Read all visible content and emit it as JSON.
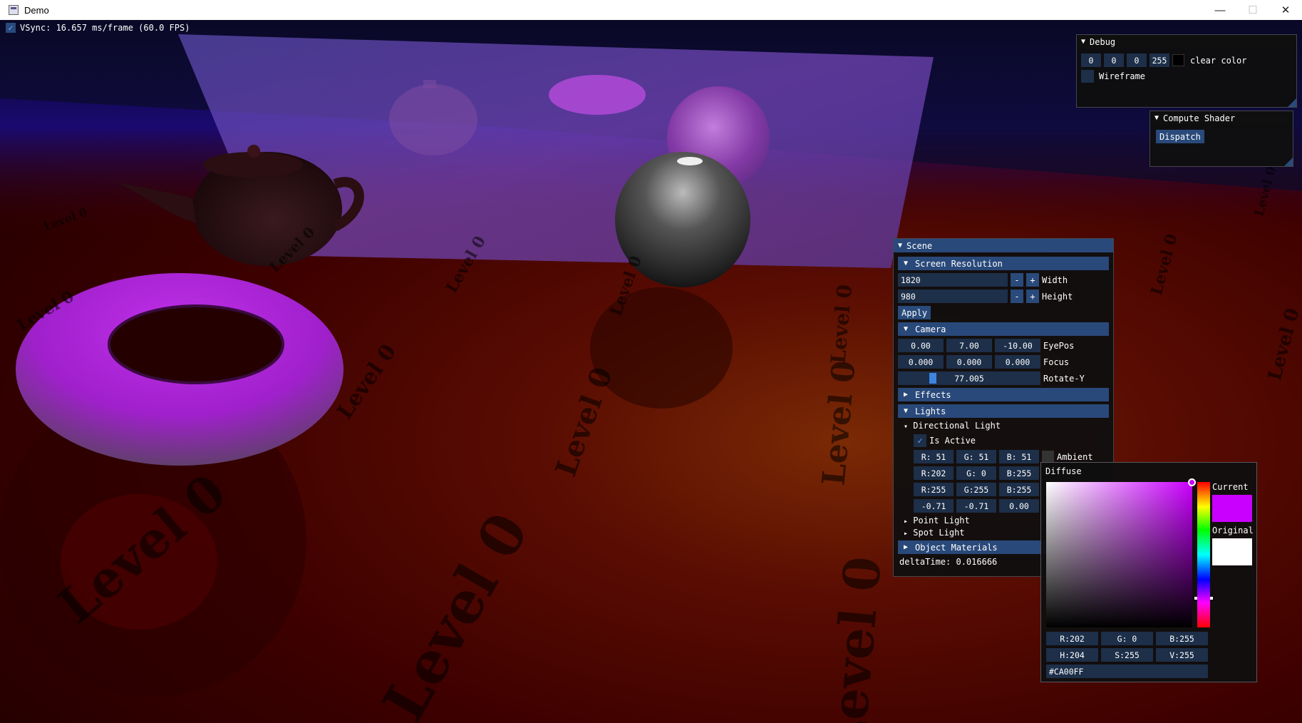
{
  "window": {
    "title": "Demo",
    "minimize_icon": "minimize-icon",
    "maximize_icon": "maximize-icon",
    "close_icon": "close-icon"
  },
  "overlay": {
    "vsync_label": "VSync: 16.657 ms/frame (60.0 FPS)",
    "vsync_checked": true
  },
  "scene_text": {
    "level_label": "Level 0"
  },
  "debug": {
    "title": "Debug",
    "clear_color": {
      "r": "0",
      "g": "0",
      "b": "0",
      "a": "255",
      "label": "clear color",
      "swatch": "#000000"
    },
    "wireframe_label": "Wireframe",
    "wireframe_checked": false
  },
  "compute": {
    "title": "Compute Shader",
    "dispatch_label": "Dispatch"
  },
  "scene": {
    "title": "Scene",
    "screen_resolution": {
      "header": "Screen Resolution",
      "width_value": "1820",
      "width_label": "Width",
      "height_value": "980",
      "height_label": "Height",
      "minus": "-",
      "plus": "+",
      "apply_label": "Apply"
    },
    "camera": {
      "header": "Camera",
      "eyepos": [
        "0.00",
        "7.00",
        "-10.00"
      ],
      "eyepos_label": "EyePos",
      "focus": [
        "0.000",
        "0.000",
        "0.000"
      ],
      "focus_label": "Focus",
      "rotate_value": "77.005",
      "rotate_label": "Rotate-Y"
    },
    "effects_header": "Effects",
    "lights": {
      "header": "Lights",
      "directional": "Directional Light",
      "is_active_label": "Is Active",
      "is_active_checked": true,
      "ambient": [
        "R: 51",
        "G: 51",
        "B: 51"
      ],
      "ambient_label": "Ambient",
      "ambient_swatch": "#333333",
      "diffuse": [
        "R:202",
        "G:  0",
        "B:255"
      ],
      "specular": [
        "R:255",
        "G:255",
        "B:255"
      ],
      "direction": [
        "-0.71",
        "-0.71",
        "0.00"
      ],
      "point_light": "Point Light",
      "spot_light": "Spot Light"
    },
    "object_materials": "Object Materials",
    "delta_time": "deltaTime: 0.016666"
  },
  "picker": {
    "title": "Diffuse",
    "current_label": "Current",
    "original_label": "Original",
    "current_color": "#CA00FF",
    "original_color": "#FFFFFF",
    "rgb": [
      "R:202",
      "G:  0",
      "B:255"
    ],
    "hsv": [
      "H:204",
      "S:255",
      "V:255"
    ],
    "hex": "#CA00FF"
  }
}
